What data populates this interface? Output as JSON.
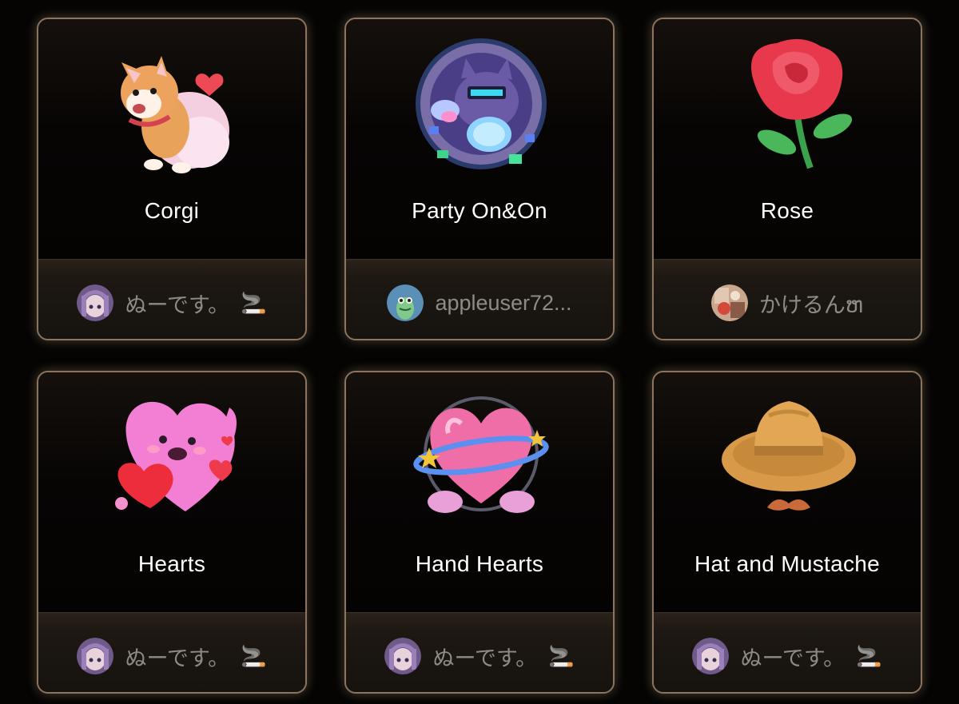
{
  "gifts": [
    {
      "name": "Corgi",
      "sender": "ぬーです。",
      "badge": "🚬",
      "art_icon": "corgi-icon",
      "avatar_icon": "anime-girl-avatar"
    },
    {
      "name": "Party On&On",
      "sender": "appleuser72...",
      "badge": "",
      "art_icon": "party-cat-icon",
      "avatar_icon": "frog-avatar"
    },
    {
      "name": "Rose",
      "sender": "かけるんຫ",
      "badge": "",
      "art_icon": "rose-icon",
      "avatar_icon": "photo-avatar"
    },
    {
      "name": "Hearts",
      "sender": "ぬーです。",
      "badge": "🚬",
      "art_icon": "hearts-icon",
      "avatar_icon": "anime-girl-avatar"
    },
    {
      "name": "Hand Hearts",
      "sender": "ぬーです。",
      "badge": "🚬",
      "art_icon": "hand-hearts-icon",
      "avatar_icon": "anime-girl-avatar"
    },
    {
      "name": "Hat and Mustache",
      "sender": "ぬーです。",
      "badge": "🚬",
      "art_icon": "hat-mustache-icon",
      "avatar_icon": "anime-girl-avatar"
    }
  ],
  "colors": {
    "card_border": "#8c7560",
    "card_glow": "#d2af87",
    "gift_name_text": "#ffffff",
    "sender_text": "#8e8a86"
  }
}
